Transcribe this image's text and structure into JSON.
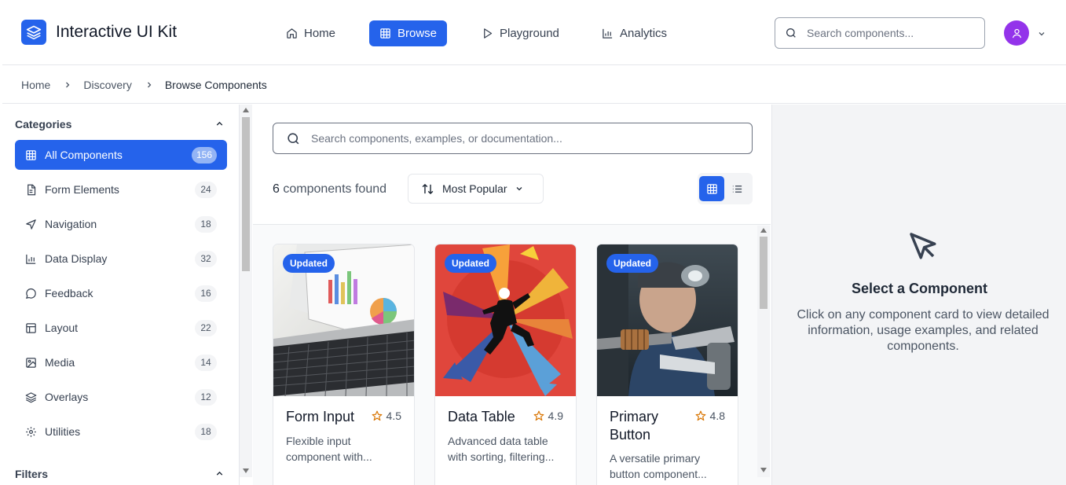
{
  "header": {
    "app_title": "Interactive UI Kit",
    "nav": [
      {
        "label": "Home",
        "icon": "home-icon",
        "active": false
      },
      {
        "label": "Browse",
        "icon": "grid-icon",
        "active": true
      },
      {
        "label": "Playground",
        "icon": "play-icon",
        "active": false
      },
      {
        "label": "Analytics",
        "icon": "bar-chart-icon",
        "active": false
      }
    ],
    "search_placeholder": "Search components...",
    "accent_color": "#2563eb",
    "avatar_color": "#9333ea"
  },
  "breadcrumb": [
    "Home",
    "Discovery",
    "Browse Components"
  ],
  "sidebar": {
    "categories_heading": "Categories",
    "categories": [
      {
        "label": "All Components",
        "count": "156",
        "icon": "grid-icon",
        "active": true
      },
      {
        "label": "Form Elements",
        "count": "24",
        "icon": "document-icon",
        "active": false
      },
      {
        "label": "Navigation",
        "count": "18",
        "icon": "navigation-arrow-icon",
        "active": false
      },
      {
        "label": "Data Display",
        "count": "32",
        "icon": "bar-chart-icon",
        "active": false
      },
      {
        "label": "Feedback",
        "count": "16",
        "icon": "message-circle-icon",
        "active": false
      },
      {
        "label": "Layout",
        "count": "22",
        "icon": "layout-icon",
        "active": false
      },
      {
        "label": "Media",
        "count": "14",
        "icon": "image-icon",
        "active": false
      },
      {
        "label": "Overlays",
        "count": "12",
        "icon": "layers-icon",
        "active": false
      },
      {
        "label": "Utilities",
        "count": "18",
        "icon": "gear-icon",
        "active": false
      }
    ],
    "filters_heading": "Filters"
  },
  "main": {
    "search_placeholder": "Search components, examples, or documentation...",
    "results_count": "6",
    "results_label": "components found",
    "sort_label": "Most Popular",
    "view_mode": "grid",
    "cards": [
      {
        "badge": "Updated",
        "title": "Form Input",
        "rating": "4.5",
        "description_lines": [
          "Flexible input",
          "component with..."
        ]
      },
      {
        "badge": "Updated",
        "title": "Data Table",
        "rating": "4.9",
        "description_lines": [
          "Advanced data table",
          "with sorting, filtering..."
        ]
      },
      {
        "badge": "Updated",
        "title": "Primary Button",
        "rating": "4.8",
        "description_lines": [
          "A versatile primary",
          "button component..."
        ]
      }
    ]
  },
  "detail": {
    "title": "Select a Component",
    "text": "Click on any component card to view detailed information, usage examples, and related components."
  }
}
